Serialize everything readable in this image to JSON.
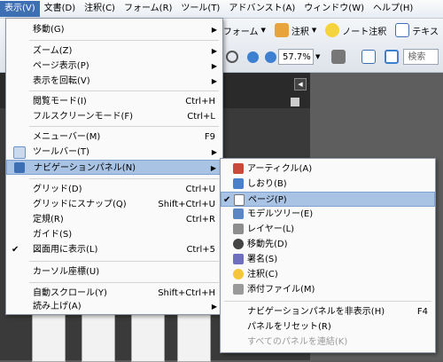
{
  "menubar": {
    "items": [
      {
        "label": "表示(V)",
        "active": true
      },
      {
        "label": "文書(D)"
      },
      {
        "label": "注釈(C)"
      },
      {
        "label": "フォーム(R)"
      },
      {
        "label": "ツール(T)"
      },
      {
        "label": "アドバンスト(A)"
      },
      {
        "label": "ウィンドウ(W)"
      },
      {
        "label": "ヘルプ(H)"
      }
    ]
  },
  "toolbar": {
    "form_label": "フォーム",
    "annotation_label": "注釈",
    "note_label": "ノート注釈",
    "text_label": "テキス",
    "zoom_value": "57.7%",
    "search_placeholder": "検索"
  },
  "view_menu": {
    "items": [
      {
        "label": "移動(G)",
        "arrow": "▶"
      },
      {
        "label": "ズーム(Z)",
        "arrow": "▶"
      },
      {
        "label": "ページ表示(P)",
        "arrow": "▶"
      },
      {
        "label": "表示を回転(V)",
        "arrow": "▶"
      },
      {
        "label": "閲覧モード(I)",
        "shortcut": "Ctrl+H"
      },
      {
        "label": "フルスクリーンモード(F)",
        "shortcut": "Ctrl+L"
      },
      {
        "label": "メニューバー(M)",
        "shortcut": "F9"
      },
      {
        "label": "ツールバー(T)",
        "arrow": "▶"
      },
      {
        "label": "ナビゲーションパネル(N)",
        "arrow": "▶"
      },
      {
        "label": "グリッド(D)",
        "shortcut": "Ctrl+U"
      },
      {
        "label": "グリッドにスナップ(Q)",
        "shortcut": "Shift+Ctrl+U"
      },
      {
        "label": "定規(R)",
        "shortcut": "Ctrl+R"
      },
      {
        "label": "ガイド(S)"
      },
      {
        "label": "図面用に表示(L)",
        "shortcut": "Ctrl+5",
        "check": "✔"
      },
      {
        "label": "カーソル座標(U)"
      },
      {
        "label": "自動スクロール(Y)",
        "shortcut": "Shift+Ctrl+H"
      },
      {
        "label": "読み上げ(A)",
        "arrow": "▶"
      }
    ]
  },
  "nav_submenu": {
    "items": [
      {
        "label": "アーティクル(A)"
      },
      {
        "label": "しおり(B)"
      },
      {
        "label": "ページ(P)",
        "check": "✔"
      },
      {
        "label": "モデルツリー(E)"
      },
      {
        "label": "レイヤー(L)"
      },
      {
        "label": "移動先(D)"
      },
      {
        "label": "署名(S)"
      },
      {
        "label": "注釈(C)"
      },
      {
        "label": "添付ファイル(M)"
      },
      {
        "label": "ナビゲーションパネルを非表示(H)",
        "shortcut": "F4"
      },
      {
        "label": "パネルをリセット(R)"
      },
      {
        "label": "すべてのパネルを連結(K)"
      }
    ]
  },
  "colors": {
    "highlight": "#a8c3e4",
    "menubar_active": "#3d6fb5"
  }
}
